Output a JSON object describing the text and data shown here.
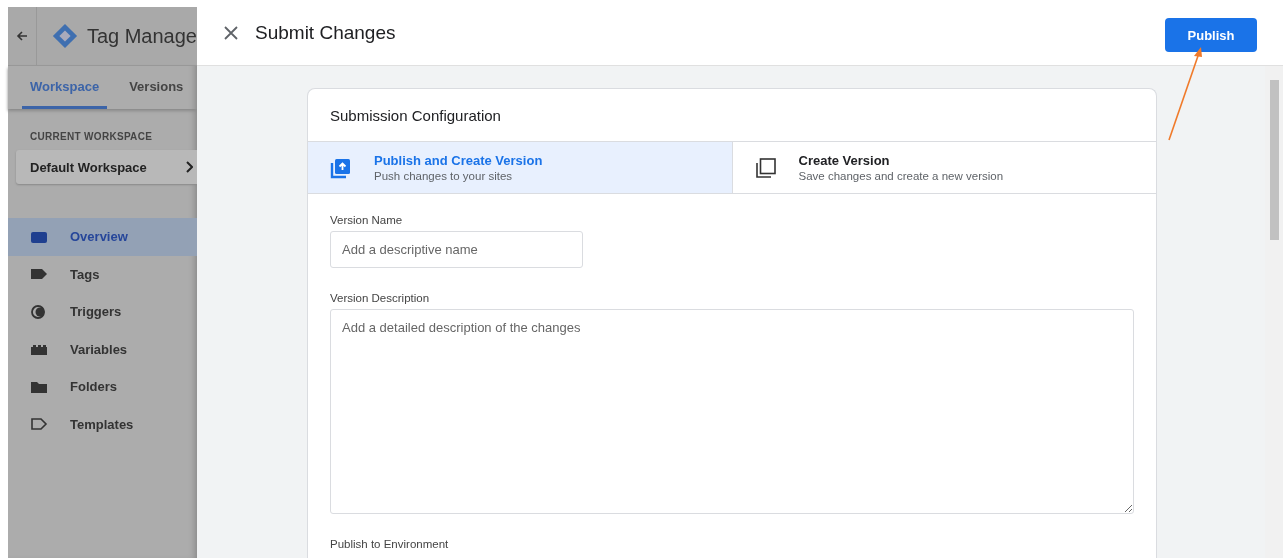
{
  "app": {
    "title": "Tag Manage",
    "tabs": [
      {
        "label": "Workspace",
        "selected": true
      },
      {
        "label": "Versions",
        "selected": false
      }
    ],
    "current_workspace": {
      "heading": "CURRENT WORKSPACE",
      "value": "Default Workspace"
    },
    "nav": [
      {
        "label": "Overview",
        "selected": true
      },
      {
        "label": "Tags",
        "selected": false
      },
      {
        "label": "Triggers",
        "selected": false
      },
      {
        "label": "Variables",
        "selected": false
      },
      {
        "label": "Folders",
        "selected": false
      },
      {
        "label": "Templates",
        "selected": false
      }
    ]
  },
  "dialog": {
    "title": "Submit Changes",
    "publish_button": "Publish",
    "card_title": "Submission Configuration",
    "options": [
      {
        "title": "Publish and Create Version",
        "subtitle": "Push changes to your sites",
        "selected": true
      },
      {
        "title": "Create Version",
        "subtitle": "Save changes and create a new version",
        "selected": false
      }
    ],
    "version_name": {
      "label": "Version Name",
      "placeholder": "Add a descriptive name"
    },
    "version_description": {
      "label": "Version Description",
      "placeholder": "Add a detailed description of the changes"
    },
    "environment_label": "Publish to Environment"
  }
}
